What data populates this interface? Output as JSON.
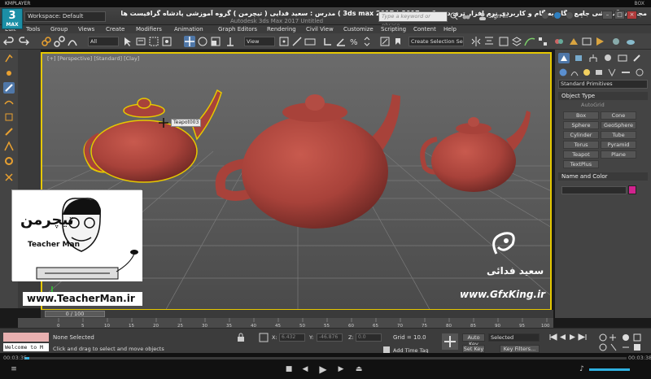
{
  "player": {
    "name": "KMPLAYER",
    "top_right": "BOX",
    "time_elapsed": "00:03:35",
    "time_total": "00:03:38"
  },
  "app": {
    "logo_text": "3",
    "logo_sub": "MAX",
    "workspace": "Workspace: Default",
    "title_fa": "مجموعه آموزشی جامع ، گام به گام و کاربردی نرم افزار تری دی مکس 2017 ( 3ds max 2017 )  مدرس : سعید فدایی ( تیچرمن ) گروه آموزشی پادشاه گرافیست ها",
    "document_title": "Autodesk 3ds Max 2017     Untitled",
    "search_placeholder": "Type a keyword or phrase",
    "sign_in": "Sign In"
  },
  "menu": [
    "Edit",
    "Tools",
    "Group",
    "Views",
    "Create",
    "Modifiers",
    "Animation",
    "Graph Editors",
    "Rendering",
    "Civil View",
    "Customize",
    "Scripting",
    "Content",
    "Help"
  ],
  "toolbar": {
    "filter": "All",
    "ref_coord": "View",
    "selection_set": "Create Selection Se"
  },
  "viewport": {
    "label": "[+] [Perspective] [Standard] [Clay]",
    "tooltip": "Teapot003",
    "teacher_name": "Teacher Man",
    "teacher_url": "www.TeacherMan.ir",
    "watermark_name": "سعید فدائی",
    "watermark_url": "www.GfxKing.ir",
    "teapot_color": "#a8423a",
    "selection_color": "#e6c800"
  },
  "command_panel": {
    "dropdown": "Standard Primitives",
    "object_type_title": "Object Type",
    "autogrid": "AutoGrid",
    "primitives": [
      "Box",
      "Cone",
      "Sphere",
      "GeoSphere",
      "Cylinder",
      "Tube",
      "Torus",
      "Pyramid",
      "Teapot",
      "Plane",
      "TextPlus"
    ],
    "name_color_title": "Name and Color",
    "object_color": "#d1238e"
  },
  "timeline": {
    "slider_label": "0 / 100",
    "ticks": [
      "0",
      "5",
      "10",
      "15",
      "20",
      "25",
      "30",
      "35",
      "40",
      "45",
      "50",
      "55",
      "60",
      "65",
      "70",
      "75",
      "80",
      "85",
      "90",
      "95",
      "100"
    ]
  },
  "status": {
    "maxscript": "Welcome to M",
    "selection": "None Selected",
    "prompt": "Click and drag to select and move objects",
    "x_label": "X:",
    "x_value": "6.432",
    "y_label": "Y:",
    "y_value": "-46.876",
    "z_label": "Z:",
    "z_value": "0.0",
    "grid": "Grid = 10.0",
    "add_time_tag": "Add Time Tag",
    "auto_key": "Auto Key",
    "set_key": "Set Key",
    "selected": "Selected",
    "key_filters": "Key Filters..."
  }
}
